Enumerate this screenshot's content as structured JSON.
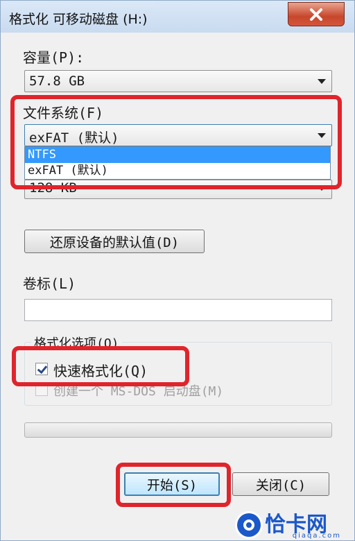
{
  "window": {
    "title": "格式化 可移动磁盘 (H:)"
  },
  "capacity": {
    "label": "容量(P):",
    "value": "57.8 GB"
  },
  "filesystem": {
    "label": "文件系统(F)",
    "value": "exFAT (默认)",
    "options": [
      "NTFS",
      "exFAT (默认)"
    ],
    "selected_option": "NTFS"
  },
  "allocation": {
    "value": "128 KB"
  },
  "restore_defaults_label": "还原设备的默认值(D)",
  "volume": {
    "label": "卷标(L)",
    "value": ""
  },
  "format_options": {
    "title": "格式化选项(O)",
    "quick_format_label": "快速格式化(Q)",
    "quick_format_checked": true,
    "msdos_label": "创建一个 MS-DOS 启动盘(M)",
    "msdos_checked": false
  },
  "buttons": {
    "start_label": "开始(S)",
    "close_label": "关闭(C)"
  },
  "watermark": {
    "text": "恰卡网",
    "sub": "qiaqa.com"
  },
  "colors": {
    "highlight": "#e0242c",
    "selection": "#3399ff",
    "close_button": "#c7472d"
  }
}
